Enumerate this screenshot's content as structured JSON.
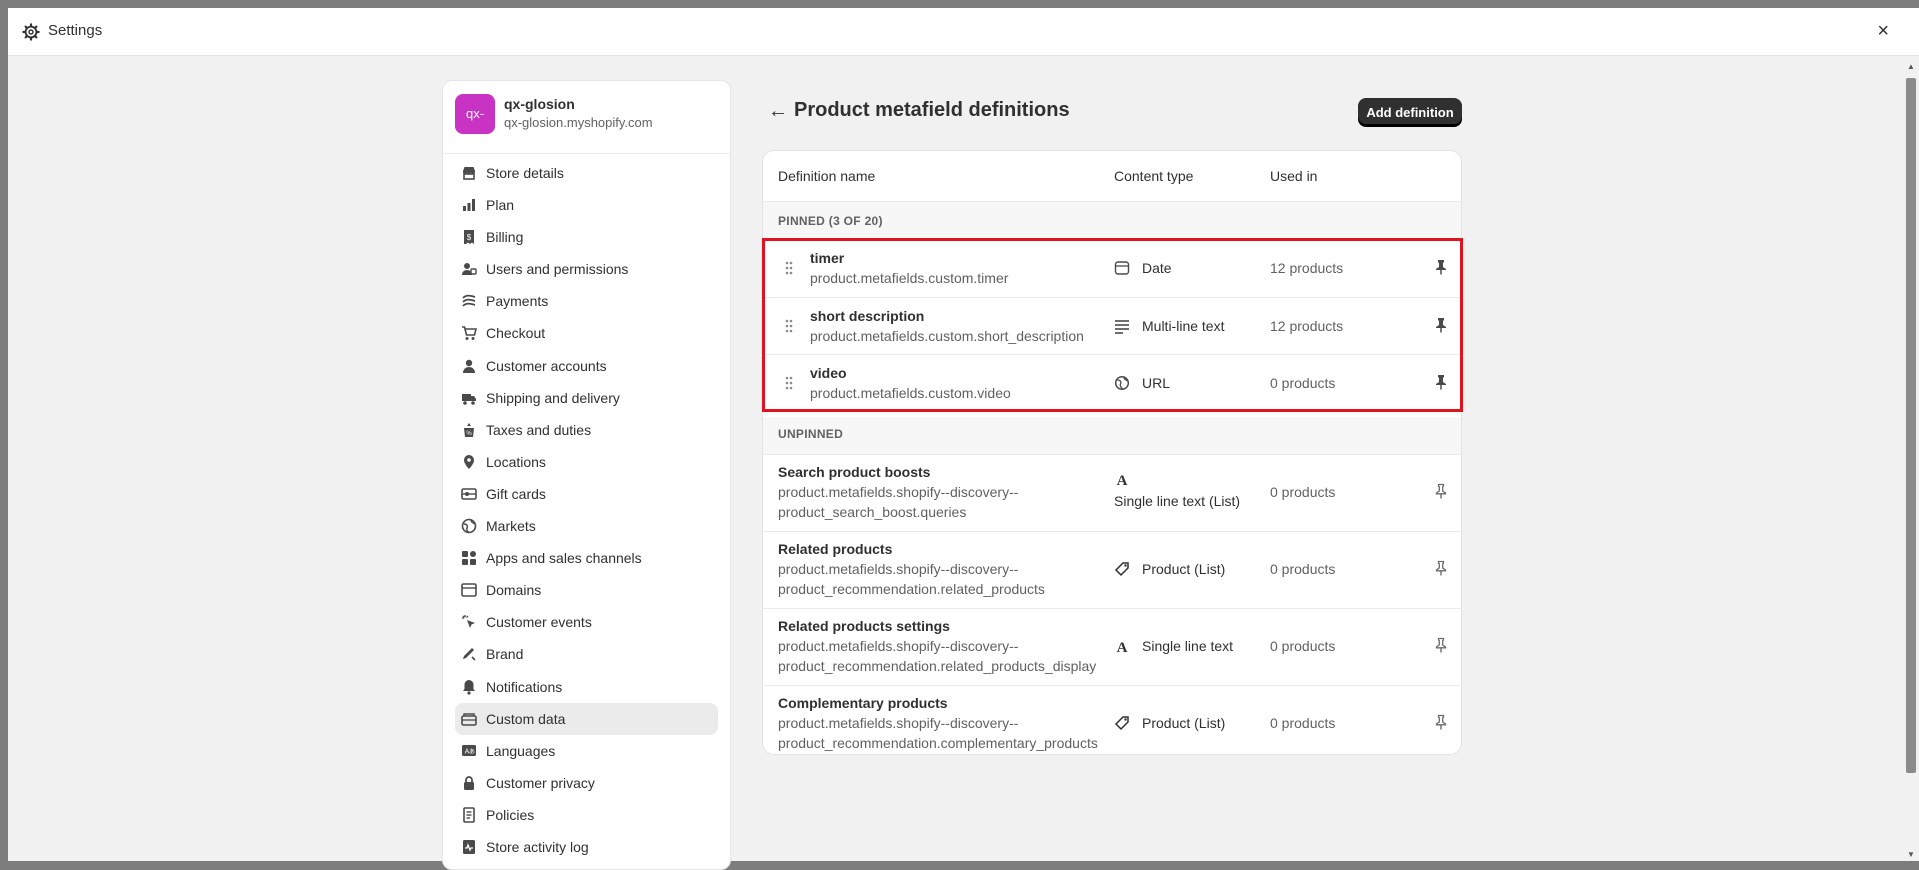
{
  "window": {
    "title": "Settings",
    "close_label": "×"
  },
  "store": {
    "avatar_text": "qx-",
    "name": "qx-glosion",
    "domain": "qx-glosion.myshopify.com"
  },
  "nav": {
    "items": [
      {
        "label": "Store details",
        "icon": "store-icon"
      },
      {
        "label": "Plan",
        "icon": "plan-icon"
      },
      {
        "label": "Billing",
        "icon": "billing-icon"
      },
      {
        "label": "Users and permissions",
        "icon": "users-icon"
      },
      {
        "label": "Payments",
        "icon": "payments-icon"
      },
      {
        "label": "Checkout",
        "icon": "cart-icon"
      },
      {
        "label": "Customer accounts",
        "icon": "person-icon"
      },
      {
        "label": "Shipping and delivery",
        "icon": "truck-icon"
      },
      {
        "label": "Taxes and duties",
        "icon": "tax-icon"
      },
      {
        "label": "Locations",
        "icon": "location-icon"
      },
      {
        "label": "Gift cards",
        "icon": "gift-card-icon"
      },
      {
        "label": "Markets",
        "icon": "globe-icon"
      },
      {
        "label": "Apps and sales channels",
        "icon": "apps-icon"
      },
      {
        "label": "Domains",
        "icon": "domain-icon"
      },
      {
        "label": "Customer events",
        "icon": "cursor-icon"
      },
      {
        "label": "Brand",
        "icon": "brand-icon"
      },
      {
        "label": "Notifications",
        "icon": "bell-icon"
      },
      {
        "label": "Custom data",
        "icon": "custom-data-icon",
        "active": true
      },
      {
        "label": "Languages",
        "icon": "language-icon"
      },
      {
        "label": "Customer privacy",
        "icon": "lock-icon"
      },
      {
        "label": "Policies",
        "icon": "policy-icon"
      },
      {
        "label": "Store activity log",
        "icon": "activity-icon"
      }
    ]
  },
  "page": {
    "title": "Product metafield definitions",
    "add_button": "Add definition",
    "columns": {
      "name": "Definition name",
      "type": "Content type",
      "used": "Used in"
    },
    "pinned_label": "PINNED (3 OF 20)",
    "unpinned_label": "UNPINNED",
    "pinned": [
      {
        "name": "timer",
        "key": "product.metafields.custom.timer",
        "type": "Date",
        "type_icon": "calendar-icon",
        "used": "12 products"
      },
      {
        "name": "short description",
        "key": "product.metafields.custom.short_description",
        "type": "Multi-line text",
        "type_icon": "multiline-text-icon",
        "used": "12 products"
      },
      {
        "name": "video",
        "key": "product.metafields.custom.video",
        "type": "URL",
        "type_icon": "link-icon",
        "used": "0 products"
      }
    ],
    "unpinned": [
      {
        "name": "Search product boosts",
        "key_line1": "product.metafields.shopify--discovery--",
        "key_line2": "product_search_boost.queries",
        "type": "Single line text (List)",
        "type_icon": "text-icon",
        "used": "0 products"
      },
      {
        "name": "Related products",
        "key_line1": "product.metafields.shopify--discovery--",
        "key_line2": "product_recommendation.related_products",
        "type": "Product (List)",
        "type_icon": "tag-icon",
        "used": "0 products"
      },
      {
        "name": "Related products settings",
        "key_line1": "product.metafields.shopify--discovery--",
        "key_line2": "product_recommendation.related_products_display",
        "type": "Single line text",
        "type_icon": "text-icon",
        "used": "0 products"
      },
      {
        "name": "Complementary products",
        "key_line1": "product.metafields.shopify--discovery--",
        "key_line2": "product_recommendation.complementary_products",
        "type": "Product (List)",
        "type_icon": "tag-icon",
        "used": "0 products"
      }
    ]
  },
  "colors": {
    "highlight": "#e0141e",
    "avatar": "#c933c4",
    "primary_button": "#303030"
  }
}
